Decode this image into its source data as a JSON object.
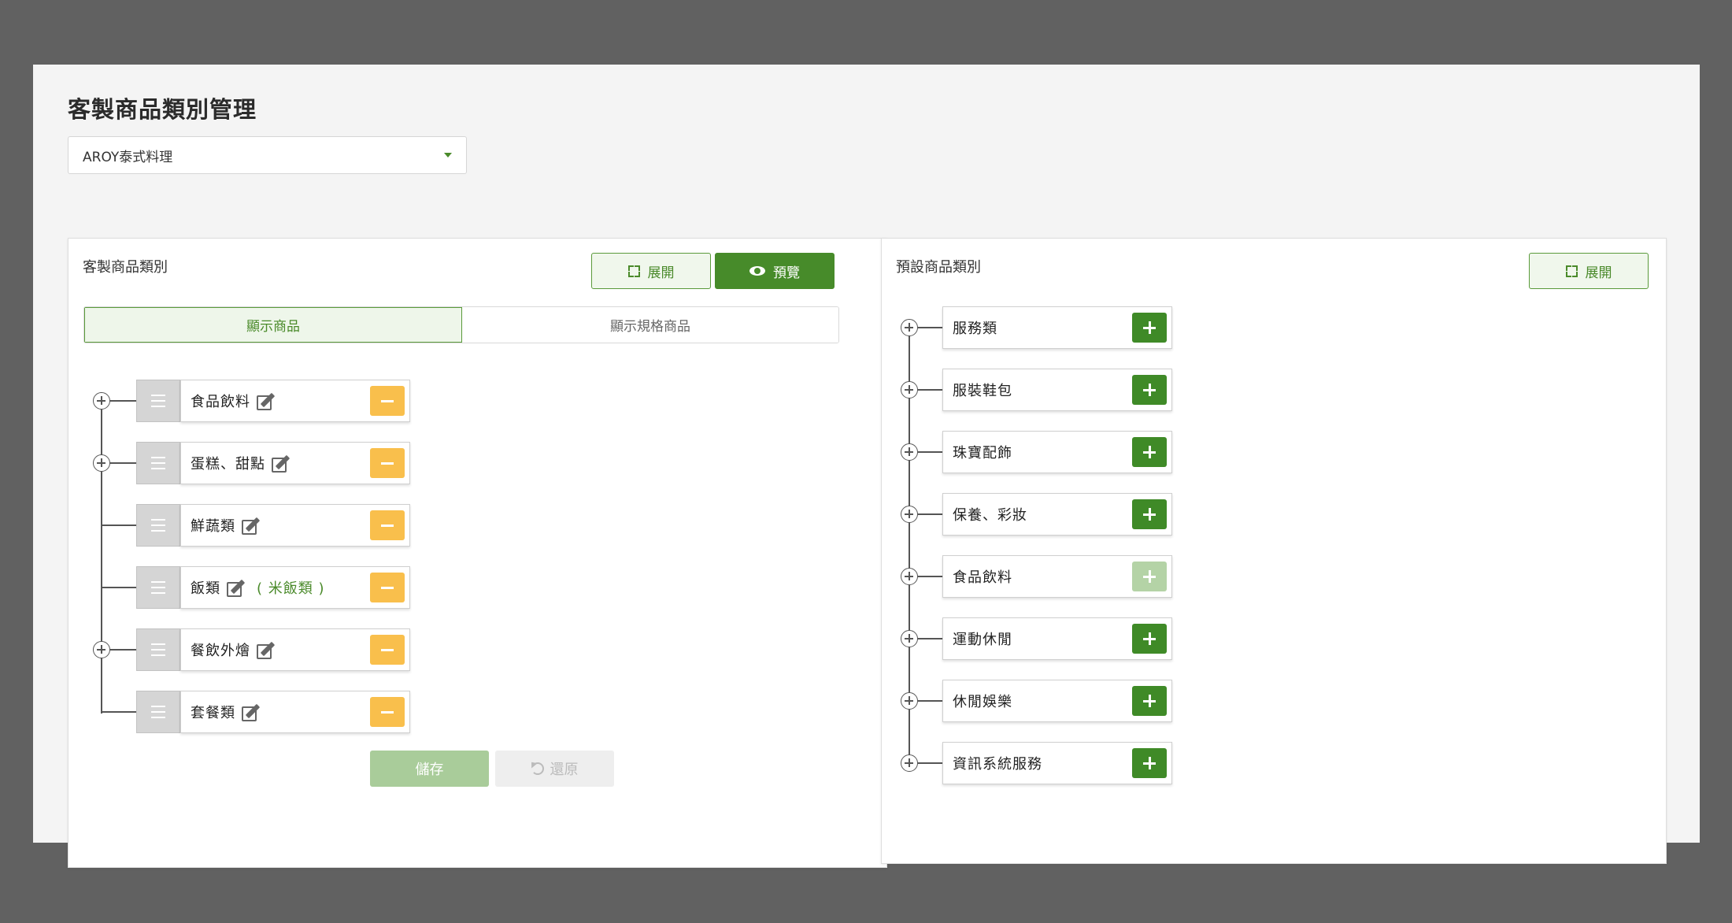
{
  "page": {
    "title": "客製商品類別管理",
    "store_select": {
      "value": "AROY泰式料理"
    }
  },
  "left_panel": {
    "heading": "客製商品類別",
    "expand_label": "展開",
    "preview_label": "預覽",
    "tabs": [
      {
        "label": "顯示商品",
        "active": true
      },
      {
        "label": "顯示規格商品",
        "active": false
      }
    ],
    "items": [
      {
        "label": "食品飲料",
        "sub": "",
        "expandable": true
      },
      {
        "label": "蛋糕、甜點",
        "sub": "",
        "expandable": true
      },
      {
        "label": "鮮蔬類",
        "sub": "",
        "expandable": false
      },
      {
        "label": "飯類",
        "sub": "( 米飯類 )",
        "expandable": false
      },
      {
        "label": "餐飲外燴",
        "sub": "",
        "expandable": true
      },
      {
        "label": "套餐類",
        "sub": "",
        "expandable": false
      }
    ],
    "save_label": "儲存",
    "restore_label": "還原"
  },
  "right_panel": {
    "heading": "預設商品類別",
    "expand_label": "展開",
    "items": [
      {
        "label": "服務類",
        "disabled": false
      },
      {
        "label": "服裝鞋包",
        "disabled": false
      },
      {
        "label": "珠寶配飾",
        "disabled": false
      },
      {
        "label": "保養、彩妝",
        "disabled": false
      },
      {
        "label": "食品飲料",
        "disabled": true
      },
      {
        "label": "運動休閒",
        "disabled": false
      },
      {
        "label": "休閒娛樂",
        "disabled": false
      },
      {
        "label": "資訊系統服務",
        "disabled": false
      }
    ]
  },
  "colors": {
    "primary_green": "#478b2a",
    "minus_yellow": "#f9bf4c",
    "disabled_green": "#b4d3a6"
  }
}
